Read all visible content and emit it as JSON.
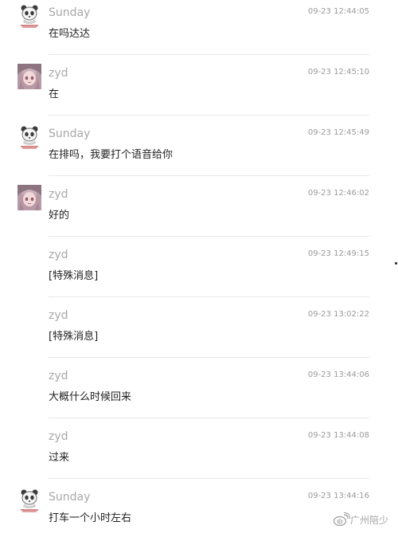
{
  "messages": [
    {
      "sender": "Sunday",
      "time": "09-23 12:44:05",
      "text": "在吗达达",
      "avatar": "panda-avatar"
    },
    {
      "sender": "zyd",
      "time": "09-23 12:45:10",
      "text": "在",
      "avatar": "anime-girl-avatar"
    },
    {
      "sender": "Sunday",
      "time": "09-23 12:45:49",
      "text": "在排吗，我要打个语音给你",
      "avatar": "panda-avatar"
    },
    {
      "sender": "zyd",
      "time": "09-23 12:46:02",
      "text": "好的",
      "avatar": "anime-girl-avatar"
    },
    {
      "sender": "zyd",
      "time": "09-23 12:49:15",
      "text": "[特殊消息]",
      "avatar": ""
    },
    {
      "sender": "zyd",
      "time": "09-23 13:02:22",
      "text": "[特殊消息]",
      "avatar": ""
    },
    {
      "sender": "zyd",
      "time": "09-23 13:44:06",
      "text": "大概什么时候回来",
      "avatar": ""
    },
    {
      "sender": "zyd",
      "time": "09-23 13:44:08",
      "text": "过来",
      "avatar": ""
    },
    {
      "sender": "Sunday",
      "time": "09-23 13:44:16",
      "text": "打车一个小时左右",
      "avatar": "panda-avatar"
    }
  ],
  "watermark": {
    "text": "广州陪少",
    "icon": "weibo-icon"
  },
  "colors": {
    "sender": "#a8a8a8",
    "time": "#9b9b9b",
    "text": "#222222",
    "divider": "#e8e8e8"
  }
}
